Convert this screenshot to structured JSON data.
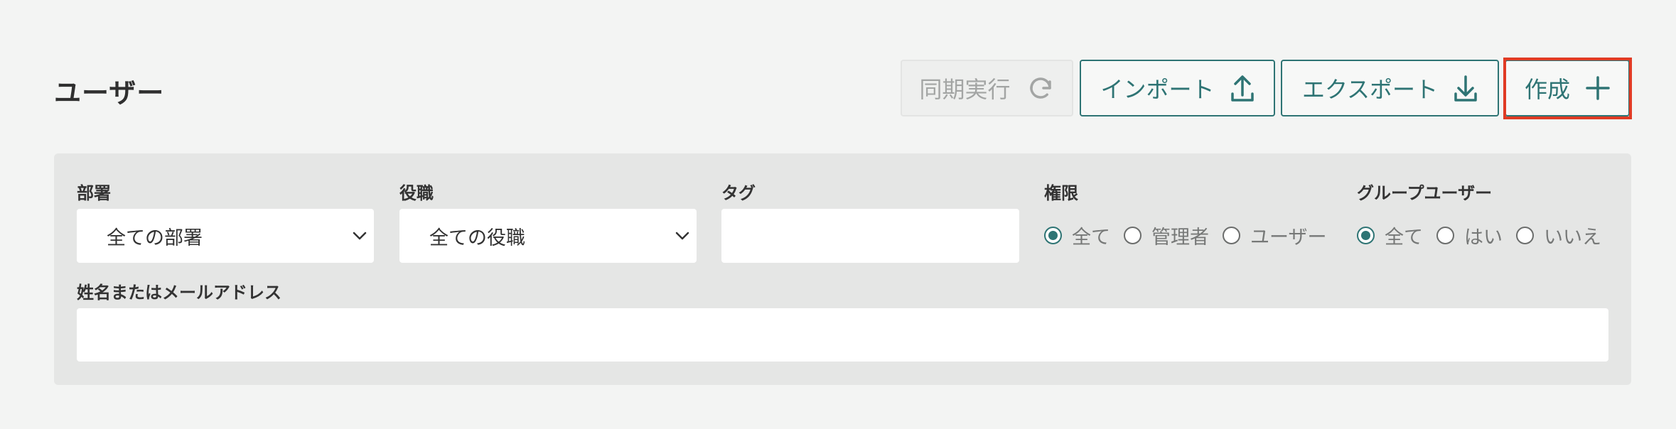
{
  "header": {
    "title": "ユーザー",
    "buttons": {
      "sync": "同期実行",
      "import": "インポート",
      "export": "エクスポート",
      "create": "作成"
    }
  },
  "filters": {
    "department": {
      "label": "部署",
      "value": "全ての部署"
    },
    "position": {
      "label": "役職",
      "value": "全ての役職"
    },
    "tag": {
      "label": "タグ",
      "value": ""
    },
    "permission": {
      "label": "権限",
      "options": [
        "全て",
        "管理者",
        "ユーザー"
      ],
      "selected": "全て"
    },
    "group_user": {
      "label": "グループユーザー",
      "options": [
        "全て",
        "はい",
        "いいえ"
      ],
      "selected": "全て"
    },
    "name_email": {
      "label": "姓名またはメールアドレス",
      "value": ""
    }
  },
  "colors": {
    "accent": "#2e7474",
    "highlight": "#e03b24",
    "panel": "#e5e6e5",
    "background": "#f3f4f3"
  },
  "icons": [
    "sync-icon",
    "upload-icon",
    "download-icon",
    "plus-icon",
    "chevron-down-icon"
  ]
}
